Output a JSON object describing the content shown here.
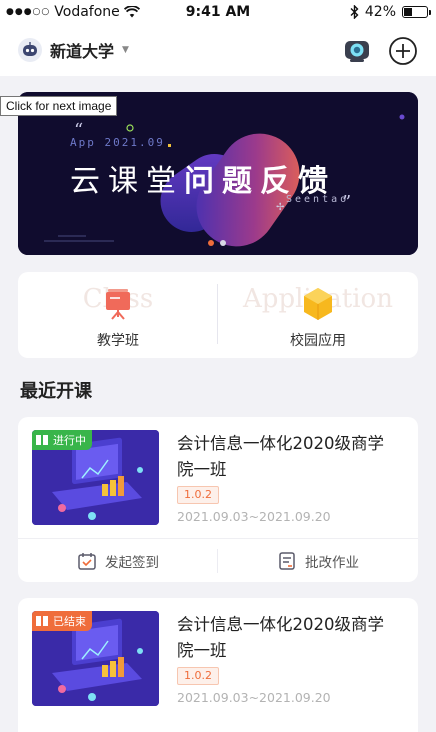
{
  "status_bar": {
    "carrier": "Vodafone",
    "time": "9:41 AM",
    "battery": "42%",
    "battery_level": 0.42
  },
  "header": {
    "school_name": "新道大学",
    "icons": [
      "robot-avatar-icon",
      "camera-icon",
      "add-icon"
    ]
  },
  "tooltip": "Click for next image",
  "banner": {
    "subtitle": "App 2021.09",
    "title_light": "云课堂",
    "title_bold": "问题反馈",
    "brand": "Seentao",
    "slides": 2,
    "active_slide": 0
  },
  "tiles": [
    {
      "label": "教学班",
      "ghost": "Class",
      "icon": "presentation-board-icon",
      "color": "#f06a5a"
    },
    {
      "label": "校园应用",
      "ghost": "Application",
      "icon": "cube-icon",
      "color": "#f7b81e"
    }
  ],
  "recent": {
    "title": "最近开课",
    "courses": [
      {
        "status": "进行中",
        "status_kind": "ongoing",
        "name": "会计信息一体化2020级商学院一班",
        "version": "1.0.2",
        "dates": "2021.09.03~2021.09.20",
        "actions": [
          "发起签到",
          "批改作业"
        ]
      },
      {
        "status": "已结束",
        "status_kind": "ended",
        "name": "会计信息一体化2020级商学院一班",
        "version": "1.0.2",
        "dates": "2021.09.03~2021.09.20"
      }
    ]
  },
  "colors": {
    "accent": "#ef6d3b",
    "ongoing": "#39b54a",
    "banner_bg": "#100c2e"
  }
}
